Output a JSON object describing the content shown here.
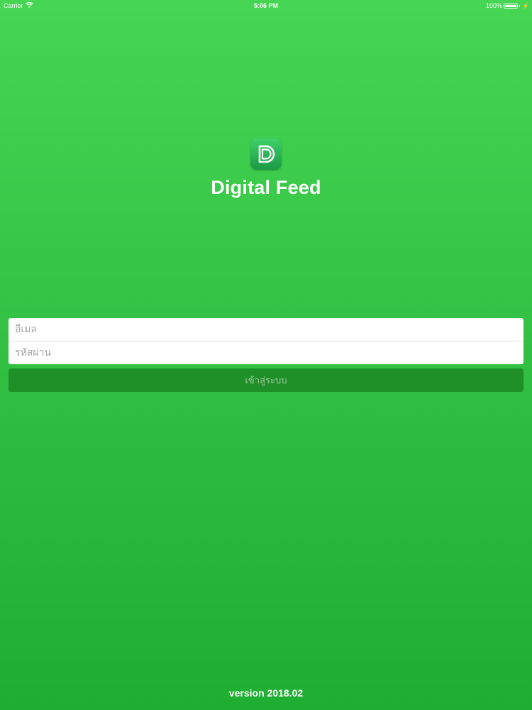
{
  "status_bar": {
    "carrier": "Carrier",
    "time": "5:06 PM",
    "battery": "100%",
    "battery_level": 1.0,
    "wifi_icon": "wifi-icon",
    "charging_icon": "bolt-icon"
  },
  "app": {
    "logo_icon": "digital-feed-logo",
    "title": "Digital Feed"
  },
  "login": {
    "email_placeholder": "อีเมล",
    "password_placeholder": "รหัสผ่าน",
    "button_label": "เข้าสู่ระบบ"
  },
  "footer": {
    "version": "version 2018.02"
  },
  "colors": {
    "background_top": "#46d653",
    "background_bottom": "#1fae32",
    "button": "#1f8f28",
    "button_text": "#9fca9f",
    "logo": "#2bb558"
  }
}
